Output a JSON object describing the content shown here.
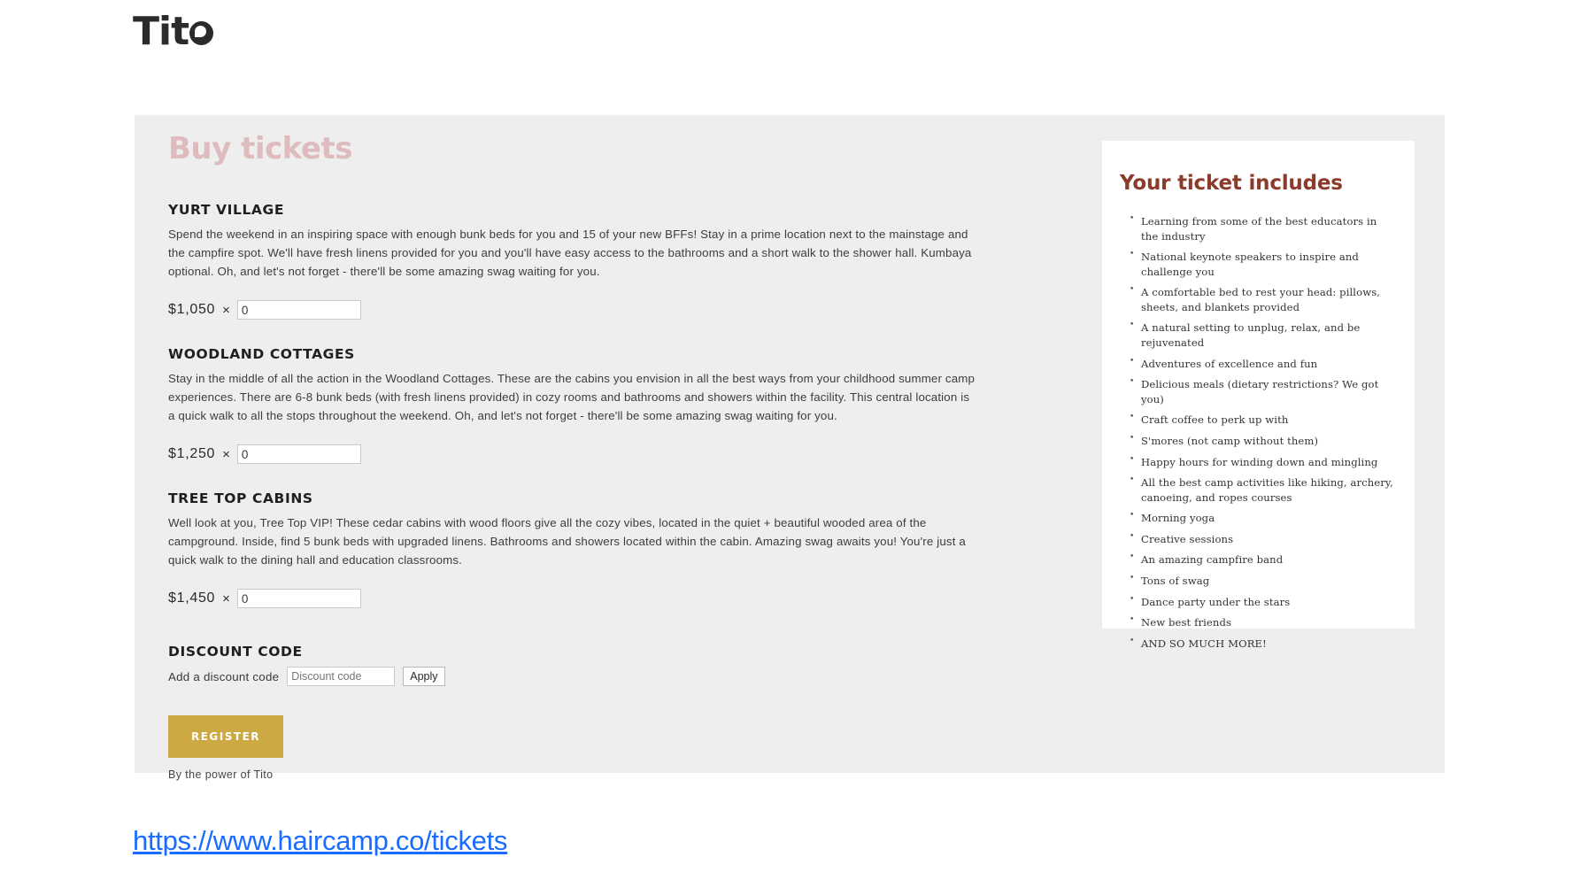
{
  "brand": {
    "logo_text": "Tit",
    "logo_mark": "o-mark-icon"
  },
  "panel": {
    "heading": "Buy tickets"
  },
  "tickets": [
    {
      "name": "YURT VILLAGE",
      "description": "Spend the weekend in an inspiring space with enough bunk beds for you and 15 of your new BFFs! Stay in a prime location next to the mainstage and the campfire spot. We'll have fresh linens provided for you and you'll have easy access to the bathrooms and a short walk to the shower hall. Kumbaya optional. Oh, and let's not forget - there'll be some amazing swag waiting for you.",
      "price": "$1,050",
      "times": "×",
      "quantity": "0"
    },
    {
      "name": "WOODLAND COTTAGES",
      "description": "Stay in the middle of all the action in the Woodland Cottages. These are the cabins you envision in all the best ways from your childhood summer camp experiences. There are 6-8 bunk beds (with fresh linens provided) in cozy rooms and bathrooms and showers within the facility. This central location is a quick walk to all the stops throughout the weekend. Oh, and let's not forget - there'll be some amazing swag waiting for you.",
      "price": "$1,250",
      "times": "×",
      "quantity": "0"
    },
    {
      "name": "TREE TOP CABINS",
      "description": "Well look at you, Tree Top VIP! These cedar cabins with wood floors give all the cozy vibes, located in the quiet + beautiful wooded area of the campground. Inside, find 5 bunk beds with upgraded linens. Bathrooms and showers located within the cabin. Amazing swag awaits you! You're just a quick walk to the dining hall and education classrooms.",
      "price": "$1,450",
      "times": "×",
      "quantity": "0"
    }
  ],
  "discount": {
    "title": "DISCOUNT CODE",
    "label": "Add a discount code",
    "placeholder": "Discount code",
    "value": "",
    "apply_label": "Apply"
  },
  "register": {
    "label": "REGISTER",
    "footer": "By the power of Tito"
  },
  "ticket_includes": {
    "heading": "Your ticket includes",
    "items": [
      "Learning from some of the best educators in the industry",
      "National keynote speakers to inspire and challenge you",
      "A comfortable bed to rest your head: pillows, sheets, and blankets provided",
      "A natural setting to unplug, relax, and be rejuvenated",
      "Adventures of excellence and fun",
      "Delicious meals (dietary restrictions? We got you)",
      "Craft coffee to perk up with",
      "S'mores (not camp without them)",
      "Happy hours for winding down and mingling",
      "All the best camp activities like hiking, archery, canoeing, and ropes courses",
      "Morning yoga",
      "Creative sessions",
      "An amazing campfire band",
      "Tons of swag",
      "Dance party under the stars",
      "New best friends",
      "AND SO MUCH MORE!"
    ]
  },
  "footer_link": {
    "url_text": "https://www.haircamp.co/tickets"
  },
  "colors": {
    "panel_bg": "#eeeeee",
    "buy_heading": "#debbbd",
    "card_heading": "#8c3a2b",
    "register_bg": "#cda944",
    "link": "#1a6bff"
  }
}
